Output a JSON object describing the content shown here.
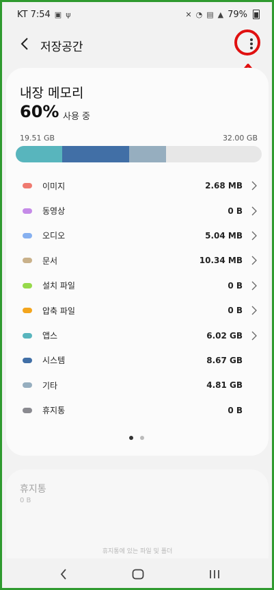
{
  "statusbar": {
    "carrier_time": "KT 7:54",
    "battery_text": "79%"
  },
  "appbar": {
    "title": "저장공간"
  },
  "storage": {
    "title": "내장 메모리",
    "percent": "60%",
    "usage_label": "사용 중",
    "used_size": "19.51 GB",
    "total_size": "32.00 GB",
    "bar_segments": [
      {
        "name": "cyan",
        "color": "#58b5bd",
        "fraction": 0.19
      },
      {
        "name": "blue",
        "color": "#416fa6",
        "fraction": 0.27
      },
      {
        "name": "gray",
        "color": "#96aebf",
        "fraction": 0.15
      }
    ],
    "categories": [
      {
        "label": "이미지",
        "value": "2.68 MB",
        "color": "#ef7a70",
        "chevron": true
      },
      {
        "label": "동영상",
        "value": "0 B",
        "color": "#c58be8",
        "chevron": true
      },
      {
        "label": "오디오",
        "value": "5.04 MB",
        "color": "#86b0f0",
        "chevron": true
      },
      {
        "label": "문서",
        "value": "10.34 MB",
        "color": "#c9b18a",
        "chevron": true
      },
      {
        "label": "설치 파일",
        "value": "0 B",
        "color": "#96d94a",
        "chevron": true
      },
      {
        "label": "압축 파일",
        "value": "0 B",
        "color": "#f3a51d",
        "chevron": true
      },
      {
        "label": "앱스",
        "value": "6.02 GB",
        "color": "#58b5bd",
        "chevron": true
      },
      {
        "label": "시스템",
        "value": "8.67 GB",
        "color": "#416fa6",
        "chevron": false
      },
      {
        "label": "기타",
        "value": "4.81 GB",
        "color": "#96aebf",
        "chevron": false
      },
      {
        "label": "휴지통",
        "value": "0 B",
        "color": "#8a8a90",
        "chevron": false
      }
    ]
  },
  "pager": {
    "active": 0,
    "count": 2
  },
  "trash_card": {
    "title": "휴지통",
    "size": "0 B",
    "description": "휴지통에 있는 파일 및 폴더"
  },
  "colors": {
    "annotation_red": "#e01010",
    "frame_green": "#2f9a2f"
  },
  "icons": {
    "back": "chevron-left-icon",
    "more": "more-vertical-icon",
    "nav_back": "chevron-left-icon",
    "nav_home": "home-icon",
    "nav_recents": "recents-icon"
  }
}
